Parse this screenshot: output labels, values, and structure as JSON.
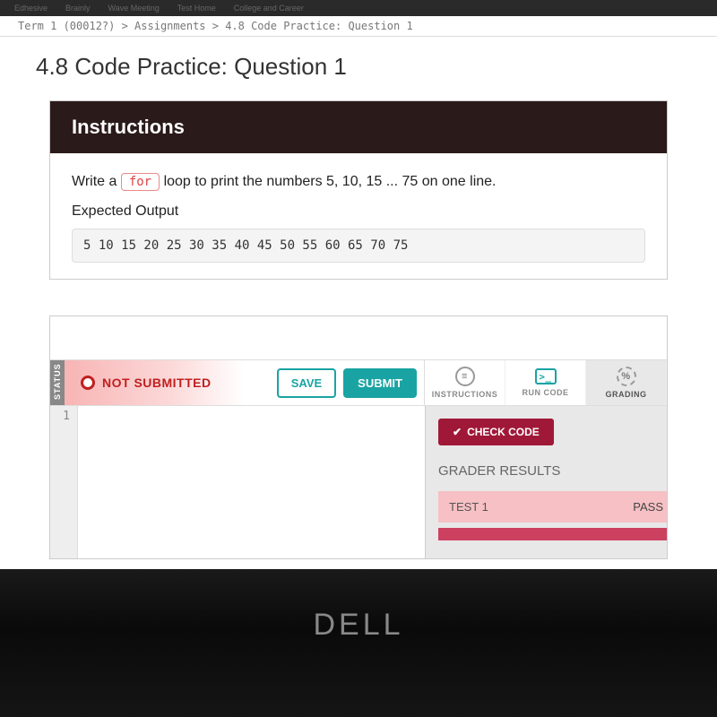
{
  "browser": {
    "tabs": [
      "Edhesive",
      "Brainly",
      "Wave Meeting",
      "Test Home",
      "College and Career"
    ]
  },
  "breadcrumb": "Term 1 (00012?) > Assignments > 4.8 Code Practice: Question 1",
  "page_title": "4.8 Code Practice: Question 1",
  "instructions": {
    "header": "Instructions",
    "text_before": "Write a ",
    "keyword": "for",
    "text_after": " loop to print the numbers 5, 10, 15 ... 75 on one line.",
    "expected_label": "Expected Output",
    "expected_output": "5 10 15 20 25 30 35 40 45 50 55 60 65 70 75"
  },
  "ide": {
    "status_tab": "STATUS",
    "status_text": "NOT SUBMITTED",
    "save_label": "SAVE",
    "submit_label": "SUBMIT",
    "tabs": {
      "instructions": "INSTRUCTIONS",
      "run": "RUN CODE",
      "grading": "GRADING"
    },
    "line_number": "1",
    "check_label": "CHECK CODE",
    "grader_title": "GRADER RESULTS",
    "test_name": "TEST 1",
    "test_result": "PASS"
  },
  "laptop_brand": "DELL"
}
